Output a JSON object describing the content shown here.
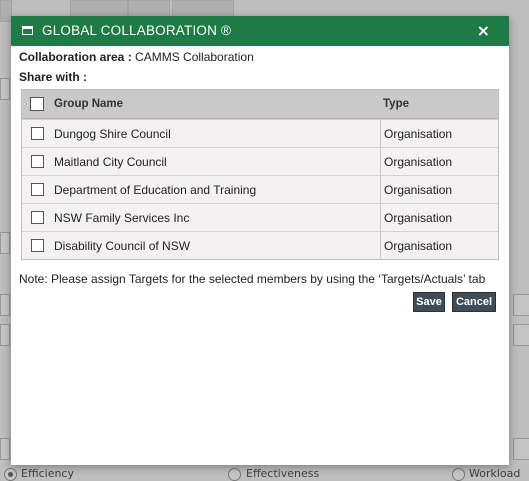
{
  "background": {
    "radio_options": [
      {
        "label": "Efficiency",
        "selected": true
      },
      {
        "label": "Effectiveness",
        "selected": false
      },
      {
        "label": "Workload",
        "selected": false
      }
    ]
  },
  "dialog": {
    "title": "GLOBAL COLLABORATION ®",
    "close_label": "×",
    "area_label": "Collaboration area :",
    "area_value": "CAMMS Collaboration",
    "share_with_label": "Share with :",
    "columns": {
      "name": "Group Name",
      "type": "Type"
    },
    "rows": [
      {
        "name": "Dungog Shire Council",
        "type": "Organisation",
        "checked": false
      },
      {
        "name": "Maitland City Council",
        "type": "Organisation",
        "checked": false
      },
      {
        "name": "Department of Education and Training",
        "type": "Organisation",
        "checked": false
      },
      {
        "name": "NSW Family Services Inc",
        "type": "Organisation",
        "checked": false
      },
      {
        "name": "Disability Council of NSW",
        "type": "Organisation",
        "checked": false
      }
    ],
    "note": "Note: Please assign Targets for the selected members by using the ‘Targets/Actuals’ tab",
    "save_label": "Save",
    "cancel_label": "Cancel",
    "colors": {
      "titlebar": "#1f7b45",
      "button": "#3e4d57",
      "header": "#c9c9c9"
    }
  }
}
